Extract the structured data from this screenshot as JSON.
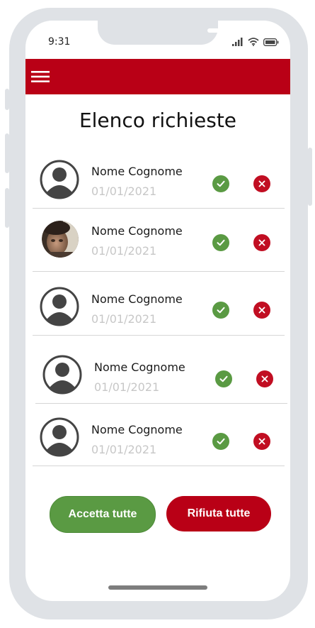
{
  "status_bar": {
    "time": "9:31"
  },
  "page": {
    "title": "Elenco richieste"
  },
  "requests": [
    {
      "name": "Nome Cognome",
      "date": "01/01/2021",
      "avatar": "default-avatar"
    },
    {
      "name": "Nome Cognome",
      "date": "01/01/2021",
      "avatar": "photo-avatar"
    },
    {
      "name": "Nome Cognome",
      "date": "01/01/2021",
      "avatar": "default-avatar"
    },
    {
      "name": "Nome Cognome",
      "date": "01/01/2021",
      "avatar": "default-avatar"
    },
    {
      "name": "Nome Cognome",
      "date": "01/01/2021",
      "avatar": "default-avatar"
    }
  ],
  "actions": {
    "accept_all": "Accetta tutte",
    "reject_all": "Rifiuta tutte"
  },
  "colors": {
    "brand_red": "#b90016",
    "accept_green": "#5a9a43",
    "reject_red": "#c10e22",
    "frame": "#dfe2e6"
  },
  "icons": {
    "menu": "hamburger-icon",
    "accept": "check-circle-icon",
    "reject": "close-circle-icon",
    "signal": "signal-icon",
    "wifi": "wifi-icon",
    "battery": "battery-icon"
  }
}
